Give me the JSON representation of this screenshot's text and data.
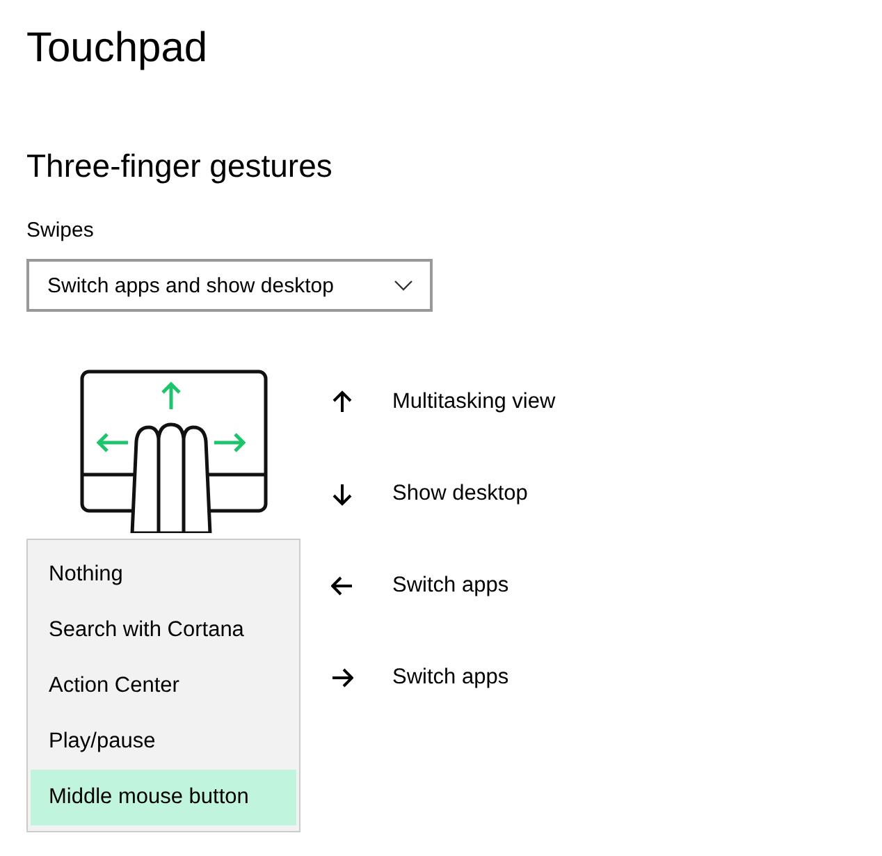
{
  "page": {
    "title": "Touchpad"
  },
  "section": {
    "heading": "Three-finger gestures"
  },
  "swipes": {
    "label": "Swipes",
    "value": "Switch apps and show desktop"
  },
  "gestures": [
    {
      "kind": "up",
      "action": "Multitasking view"
    },
    {
      "kind": "down",
      "action": "Show desktop"
    },
    {
      "kind": "left",
      "action": "Switch apps"
    },
    {
      "kind": "right",
      "action": "Switch apps"
    }
  ],
  "menu": [
    {
      "label": "Nothing",
      "selected": false
    },
    {
      "label": "Search with Cortana",
      "selected": false
    },
    {
      "label": "Action Center",
      "selected": false
    },
    {
      "label": "Play/pause",
      "selected": false
    },
    {
      "label": "Middle mouse button",
      "selected": true
    }
  ]
}
